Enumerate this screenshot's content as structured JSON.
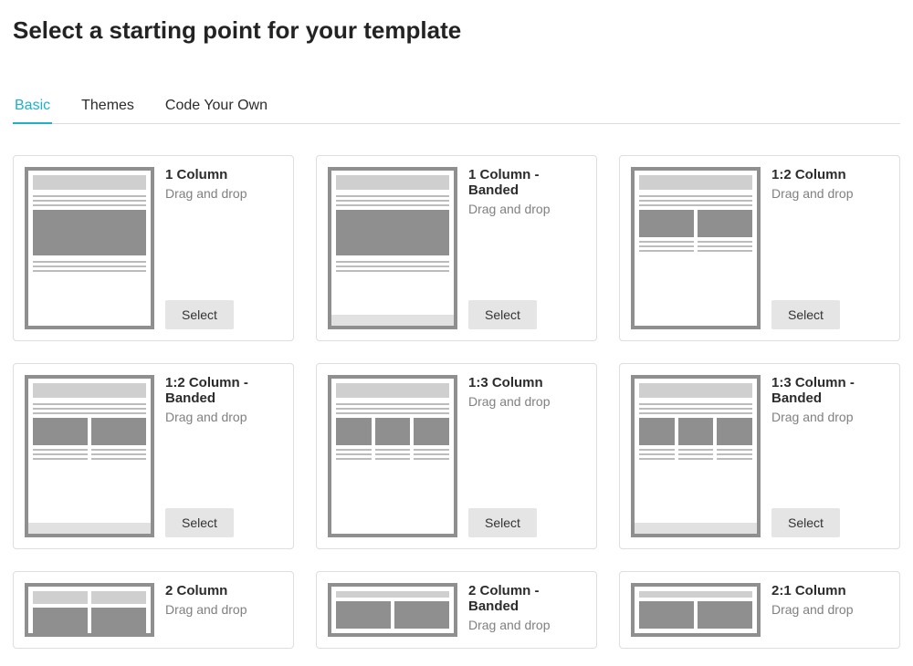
{
  "title": "Select a starting point for your template",
  "tabs": [
    {
      "label": "Basic",
      "active": true
    },
    {
      "label": "Themes",
      "active": false
    },
    {
      "label": "Code Your Own",
      "active": false
    }
  ],
  "select_label": "Select",
  "templates": [
    {
      "name": "1 Column",
      "sub": "Drag and drop",
      "layout": "one",
      "banded": false
    },
    {
      "name": "1 Column - Banded",
      "sub": "Drag and drop",
      "layout": "one",
      "banded": true
    },
    {
      "name": "1:2 Column",
      "sub": "Drag and drop",
      "layout": "one-two",
      "banded": false
    },
    {
      "name": "1:2 Column - Banded",
      "sub": "Drag and drop",
      "layout": "one-two",
      "banded": true
    },
    {
      "name": "1:3 Column",
      "sub": "Drag and drop",
      "layout": "one-three",
      "banded": false
    },
    {
      "name": "1:3 Column - Banded",
      "sub": "Drag and drop",
      "layout": "one-three",
      "banded": true
    },
    {
      "name": "2 Column",
      "sub": "Drag and drop",
      "layout": "two",
      "banded": false
    },
    {
      "name": "2 Column - Banded",
      "sub": "Drag and drop",
      "layout": "two",
      "banded": true
    },
    {
      "name": "2:1 Column",
      "sub": "Drag and drop",
      "layout": "two-one",
      "banded": false
    }
  ]
}
